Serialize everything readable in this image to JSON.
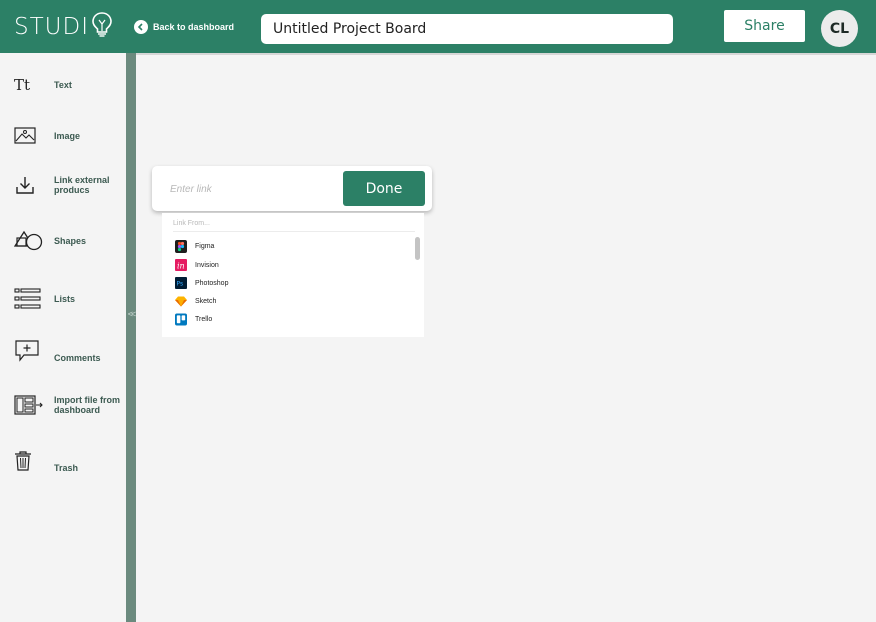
{
  "header": {
    "logo_text": "STUDI",
    "back_label": "Back to dashboard",
    "project_title": "Untitled Project Board",
    "share_label": "Share",
    "avatar_initials": "CL"
  },
  "sidebar": {
    "text_glyph": "Tt",
    "items": [
      {
        "label": "Text",
        "icon": "text-icon"
      },
      {
        "label": "Image",
        "icon": "image-icon"
      },
      {
        "label": "Link external producs",
        "icon": "download-icon"
      },
      {
        "label": "Shapes",
        "icon": "shapes-icon"
      },
      {
        "label": "Lists",
        "icon": "list-icon"
      },
      {
        "label": "Comments",
        "icon": "comment-icon"
      },
      {
        "label": "Import file from dashboard",
        "icon": "import-icon"
      },
      {
        "label": "Trash",
        "icon": "trash-icon"
      }
    ],
    "collapse_glyph": "<<"
  },
  "link_popup": {
    "input_placeholder": "Enter link",
    "done_label": "Done",
    "dropdown_header": "Link From...",
    "options": [
      {
        "label": "Figma",
        "icon": "figma-icon"
      },
      {
        "label": "Invision",
        "icon": "invision-icon"
      },
      {
        "label": "Photoshop",
        "icon": "photoshop-icon"
      },
      {
        "label": "Sketch",
        "icon": "sketch-icon"
      },
      {
        "label": "Trello",
        "icon": "trello-icon"
      }
    ]
  },
  "colors": {
    "brand": "#2c8066",
    "divider": "#6b8a7e",
    "background": "#f4f4f4"
  }
}
